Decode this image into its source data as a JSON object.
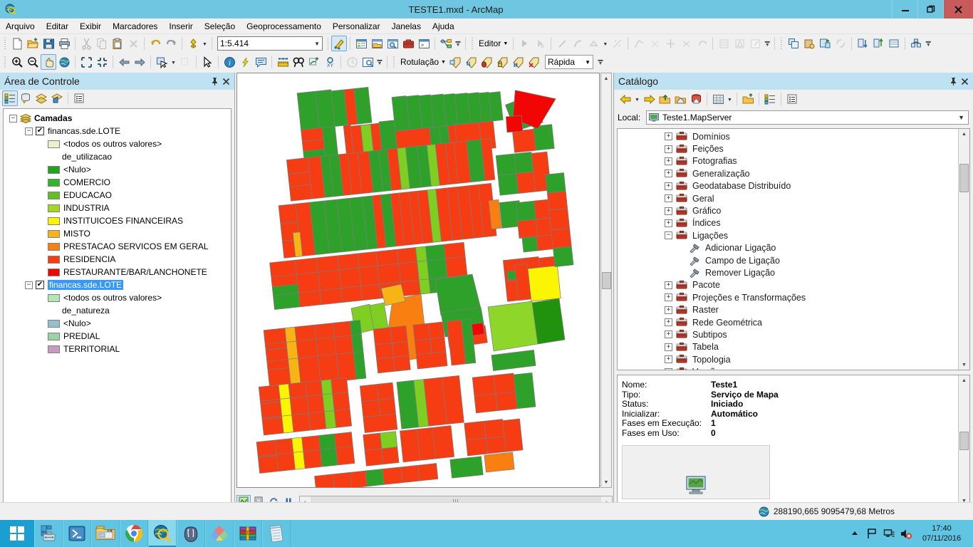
{
  "window": {
    "title": "TESTE1.mxd - ArcMap",
    "app_icon": "arcmap-globe-icon",
    "minimize": "–",
    "restore": "❐",
    "close": "✕"
  },
  "menubar": {
    "items": [
      {
        "label": "Arquivo"
      },
      {
        "label": "Editar"
      },
      {
        "label": "Exibir"
      },
      {
        "label": "Marcadores"
      },
      {
        "label": "Inserir"
      },
      {
        "label": "Seleção"
      },
      {
        "label": "Geoprocessamento"
      },
      {
        "label": "Personalizar"
      },
      {
        "label": "Janelas"
      },
      {
        "label": "Ajuda"
      }
    ]
  },
  "toolbars": {
    "scale": {
      "value": "1:5.414"
    },
    "editor_label": "Editor",
    "rotulacao_label": "Rotulação",
    "rapida_value": "Rápida",
    "standard_icons": [
      "new-document-icon",
      "open-folder-icon",
      "save-icon",
      "print-icon",
      "cut-icon",
      "copy-icon",
      "paste-icon",
      "delete-icon",
      "undo-icon",
      "redo-icon",
      "add-data-icon"
    ],
    "after_scale_icons": [
      "editor-toolbar-icon",
      "table-of-contents-icon",
      "catalog-window-icon",
      "search-window-icon",
      "arctoolbox-icon",
      "python-window-icon",
      "model-builder-icon"
    ],
    "tools_icons": [
      "zoom-in-icon",
      "zoom-out-icon",
      "pan-icon",
      "full-extent-icon",
      "fixed-zoom-in-icon",
      "fixed-zoom-out-icon",
      "go-back-extent-icon",
      "go-next-extent-icon",
      "select-features-icon",
      "clear-selection-icon",
      "select-elements-icon",
      "identify-icon",
      "hyperlink-icon",
      "html-popup-icon",
      "measure-icon",
      "find-icon",
      "find-route-icon",
      "go-to-xy-icon",
      "time-slider-icon",
      "create-viewer-icon"
    ],
    "editor_icons": [
      "edit-tool-icon",
      "edit-annotation-icon",
      "straight-segment-icon",
      "curve-segment-icon",
      "trace-icon",
      "point-icon",
      "sketch-properties-icon",
      "split-icon",
      "rotate-icon",
      "attributes-icon",
      "sketch-icon",
      "construction-icon"
    ],
    "geodb_icons": [
      "copy-features-icon",
      "paste-features-icon",
      "versioning-icon",
      "reconcile-icon",
      "post-icon",
      "refresh-version-icon",
      "version-changes-icon",
      "archiving-icon"
    ],
    "label_icons": [
      "label-manager-icon",
      "label-weight-icon",
      "label-priority-icon",
      "lock-labels-icon",
      "pause-labeling-icon",
      "view-unplaced-icon"
    ]
  },
  "toc": {
    "title": "Área de Controle",
    "pin_icon": "pin-icon",
    "close_icon": "close-icon",
    "toolbar": [
      {
        "name": "list-by-drawing-order-icon",
        "active": true
      },
      {
        "name": "list-by-source-icon",
        "active": false
      },
      {
        "name": "list-by-visibility-icon",
        "active": false
      },
      {
        "name": "list-by-selection-icon",
        "active": false
      },
      {
        "name": "toc-options-icon",
        "active": false
      }
    ],
    "root": {
      "label": "Camadas",
      "expander": "−"
    },
    "layers": [
      {
        "name": "financas.sde.LOTE",
        "checked": true,
        "selected": false,
        "expander": "−",
        "field": "de_utilizacao",
        "other_values_label": "<todos os outros valores>",
        "other_values_color": "#eef0cb",
        "entries": [
          {
            "label": "<Nulo>",
            "color": "#1ea41e"
          },
          {
            "label": "COMERCIO",
            "color": "#34b428"
          },
          {
            "label": "EDUCACAO",
            "color": "#61c120"
          },
          {
            "label": "INDUSTRIA",
            "color": "#a5d81c"
          },
          {
            "label": "INSTITUICOES FINANCEIRAS",
            "color": "#fbf504"
          },
          {
            "label": "MISTO",
            "color": "#f8b415"
          },
          {
            "label": "PRESTACAO SERVICOS EM GERAL",
            "color": "#f97f10"
          },
          {
            "label": "RESIDENCIA",
            "color": "#f53c12"
          },
          {
            "label": "RESTAURANTE/BAR/LANCHONETE",
            "color": "#f20505"
          }
        ]
      },
      {
        "name": "financas.sde.LOTE",
        "checked": true,
        "selected": true,
        "expander": "−",
        "field": "de_natureza",
        "other_values_label": "<todos os outros valores>",
        "other_values_color": "#b2e8af",
        "entries": [
          {
            "label": "<Nulo>",
            "color": "#95bfcd"
          },
          {
            "label": "PREDIAL",
            "color": "#9bd2a6"
          },
          {
            "label": "TERRITORIAL",
            "color": "#c39cc0"
          }
        ]
      }
    ]
  },
  "map": {
    "bottom_buttons": [
      {
        "name": "data-view-button",
        "active": true
      },
      {
        "name": "layout-view-button",
        "active": false
      },
      {
        "name": "refresh-view-button",
        "active": false
      },
      {
        "name": "pause-drawing-button",
        "active": false
      }
    ],
    "hscroll_grip": "|||",
    "left_arrow": "‹",
    "right_arrow": "›",
    "up_arrow": "▲",
    "down_arrow": "▼"
  },
  "catalog": {
    "title": "Catálogo",
    "pin_icon": "pin-icon",
    "close_icon": "close-icon",
    "toolbar": [
      "back-icon",
      "forward-icon",
      "up-one-level-icon",
      "home-icon",
      "default-geodatabase-icon",
      "content-view-icon",
      "connect-folder-icon",
      "toggle-tree-icon",
      "catalog-options-icon"
    ],
    "local_label": "Local:",
    "local_value": "Teste1.MapServer",
    "local_icon": "map-service-icon",
    "tree": [
      {
        "label": "Domínios",
        "expander": "+",
        "level": 0,
        "icon": "toolbox-icon"
      },
      {
        "label": "Feições",
        "expander": "+",
        "level": 0,
        "icon": "toolbox-icon"
      },
      {
        "label": "Fotografias",
        "expander": "+",
        "level": 0,
        "icon": "toolbox-icon"
      },
      {
        "label": "Generalização",
        "expander": "+",
        "level": 0,
        "icon": "toolbox-icon"
      },
      {
        "label": "Geodatabase Distribuído",
        "expander": "+",
        "level": 0,
        "icon": "toolbox-icon"
      },
      {
        "label": "Geral",
        "expander": "+",
        "level": 0,
        "icon": "toolbox-icon"
      },
      {
        "label": "Gráfico",
        "expander": "+",
        "level": 0,
        "icon": "toolbox-icon"
      },
      {
        "label": "Índices",
        "expander": "+",
        "level": 0,
        "icon": "toolbox-icon"
      },
      {
        "label": "Ligações",
        "expander": "−",
        "level": 0,
        "icon": "toolbox-icon"
      },
      {
        "label": "Adicionar Ligação",
        "expander": "",
        "level": 1,
        "icon": "tool-hammer-icon"
      },
      {
        "label": "Campo de Ligação",
        "expander": "",
        "level": 1,
        "icon": "tool-hammer-icon"
      },
      {
        "label": "Remover Ligação",
        "expander": "",
        "level": 1,
        "icon": "tool-hammer-icon"
      },
      {
        "label": "Pacote",
        "expander": "+",
        "level": 0,
        "icon": "toolbox-icon"
      },
      {
        "label": "Projeções e Transformações",
        "expander": "+",
        "level": 0,
        "icon": "toolbox-icon"
      },
      {
        "label": "Raster",
        "expander": "+",
        "level": 0,
        "icon": "toolbox-icon"
      },
      {
        "label": "Rede Geométrica",
        "expander": "+",
        "level": 0,
        "icon": "toolbox-icon"
      },
      {
        "label": "Subtipos",
        "expander": "+",
        "level": 0,
        "icon": "toolbox-icon"
      },
      {
        "label": "Tabela",
        "expander": "+",
        "level": 0,
        "icon": "toolbox-icon"
      },
      {
        "label": "Topologia",
        "expander": "+",
        "level": 0,
        "icon": "toolbox-icon"
      },
      {
        "label": "Versões",
        "expander": "+",
        "level": 0,
        "icon": "toolbox-icon"
      }
    ],
    "properties": [
      {
        "key": "Nome:",
        "value": "Teste1"
      },
      {
        "key": "Tipo:",
        "value": "Serviço de Mapa"
      },
      {
        "key": "Status:",
        "value": "Iniciado"
      },
      {
        "key": "Inicializar:",
        "value": "Automático"
      },
      {
        "key": "Fases em Execução:",
        "value": "1"
      },
      {
        "key": "Fases em Uso:",
        "value": "0"
      }
    ],
    "preview_icon": "map-service-preview-icon"
  },
  "statusbar": {
    "globe_icon": "globe-icon",
    "coordinates": "288190,665  9095479,68 Metros"
  },
  "taskbar": {
    "start_icon": "windows-start-icon",
    "items": [
      {
        "name": "server-manager-icon",
        "active": false
      },
      {
        "name": "powershell-icon",
        "active": false
      },
      {
        "name": "file-explorer-icon",
        "active": false
      },
      {
        "name": "google-chrome-icon",
        "active": false
      },
      {
        "name": "arcmap-icon",
        "active": true
      },
      {
        "name": "postgresql-icon",
        "active": false
      },
      {
        "name": "qgis-icon",
        "active": false
      },
      {
        "name": "winrar-icon",
        "active": false
      },
      {
        "name": "notepad-icon",
        "active": false
      }
    ],
    "tray": [
      {
        "name": "show-hidden-icons-icon",
        "glyph": "▲"
      },
      {
        "name": "action-center-flag-icon",
        "glyph": ""
      },
      {
        "name": "network-icon",
        "glyph": ""
      },
      {
        "name": "volume-muted-icon",
        "glyph": ""
      }
    ],
    "time": "17:40",
    "date": "07/11/2016"
  },
  "colors": {
    "titlebar": "#6ec6e0",
    "panel_header": "#bfe2f2",
    "selection_blue": "#3399ff",
    "taskbar": "#5fc5e3",
    "close_red": "#c75b5b"
  }
}
